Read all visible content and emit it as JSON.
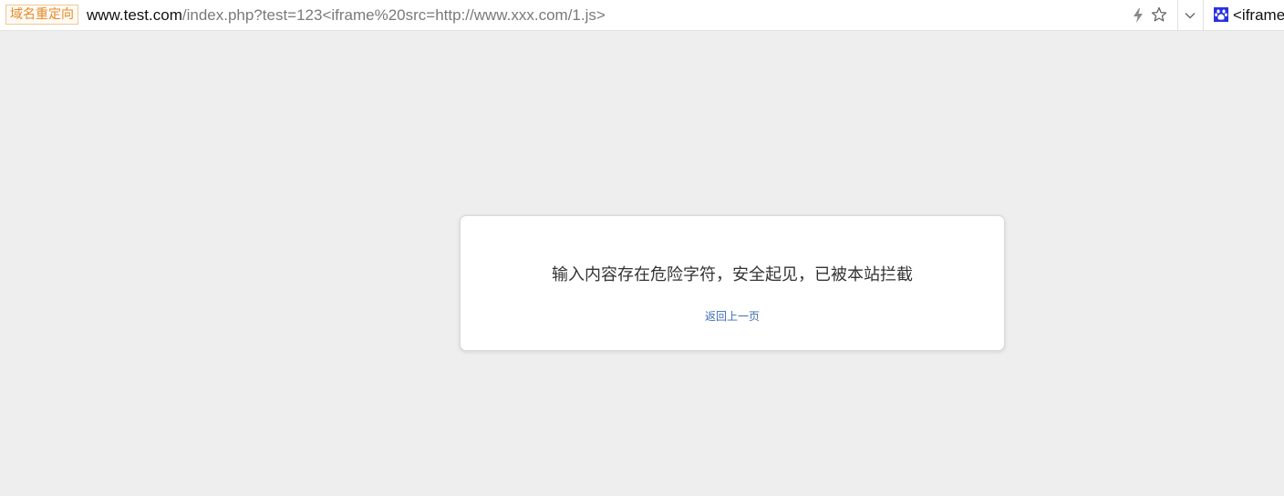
{
  "address_bar": {
    "redirect_badge": "域名重定向",
    "url_host": "www.test.com",
    "url_path": "/index.php?test=123<iframe%20src=http://www.xxx.com/1.js>",
    "icons": [
      "flash-icon",
      "star-icon",
      "chevron-down-icon"
    ]
  },
  "search_box": {
    "engine_icon": "baidu-paw-icon",
    "text": "<iframe"
  },
  "dialog": {
    "message": "输入内容存在危险字符，安全起见，已被本站拦截",
    "back_link": "返回上一页"
  },
  "colors": {
    "page_background": "#eeeeee",
    "badge_text": "#e58a2b",
    "badge_border": "#f1c796",
    "link": "#3d6db2",
    "search_engine_icon": "#2932e1"
  }
}
